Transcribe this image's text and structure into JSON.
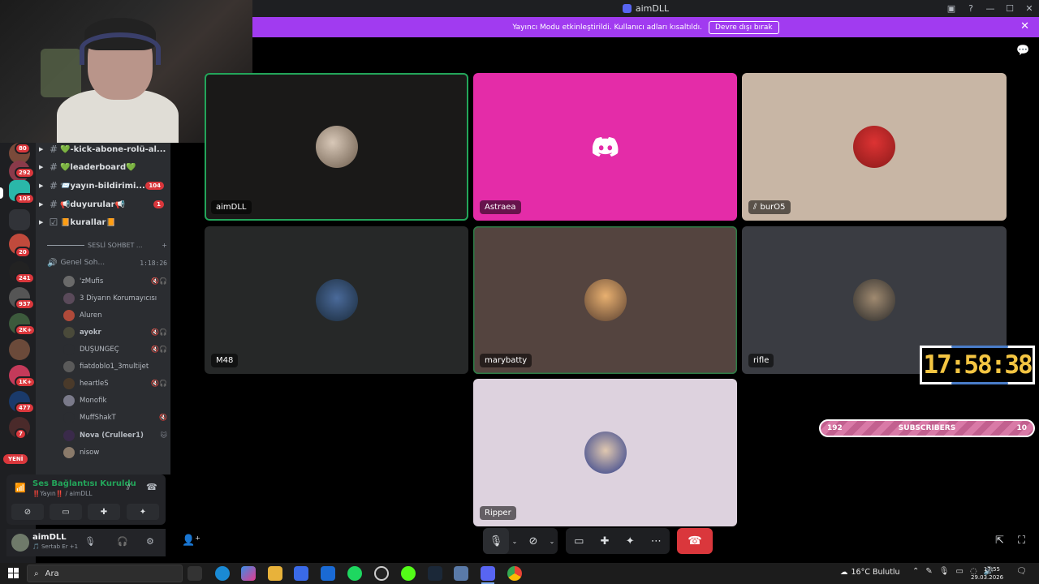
{
  "window": {
    "title": "aimDLL",
    "controls": [
      "inbox-icon",
      "help-icon",
      "minimize",
      "maximize",
      "close"
    ]
  },
  "banner": {
    "message": "Yayıncı Modu etkinleştirildi. Kullanıcı adları kısaltıldı.",
    "button_label": "Devre dışı bırak"
  },
  "server_rail": {
    "badges": [
      "80",
      "292",
      "105",
      "20",
      "241",
      "937",
      "2K+",
      "1K+",
      "477",
      "7"
    ],
    "new_label": "YENİ"
  },
  "channels": {
    "text_channels": [
      {
        "name": "💚-kick-abone-rolü-al...",
        "badge": ""
      },
      {
        "name": "💚leaderboard💚",
        "badge": ""
      },
      {
        "name": "📨yayın-bildirimi...",
        "badge": "104"
      },
      {
        "name": "📢duyurular📢",
        "badge": "1"
      },
      {
        "name": "📙kurallar📙",
        "badge": ""
      }
    ],
    "category": "SESLİ SOHBET ...",
    "voice_channel": {
      "name": "Genel Soh...",
      "timer": "1:18:26"
    },
    "voice_users": [
      {
        "name": "'zMufis",
        "icons": "🔇🎧"
      },
      {
        "name": "3 Diyarın Korumayıcısı",
        "icons": ""
      },
      {
        "name": "Aluren",
        "icons": ""
      },
      {
        "name": "ayokr",
        "icons": "🔇🎧"
      },
      {
        "name": "DÜŞÜNGEÇ",
        "icons": "🔇🎧"
      },
      {
        "name": "fiatdoblo1_3multijet",
        "icons": ""
      },
      {
        "name": "heartleS",
        "icons": "🔇🎧"
      },
      {
        "name": "Monofik",
        "icons": ""
      },
      {
        "name": "MuffShakT",
        "icons": "🔇"
      },
      {
        "name": "Nova (Crulleer1)",
        "icons": "🐱"
      },
      {
        "name": "nisow",
        "icons": ""
      }
    ]
  },
  "voice_panel": {
    "status": "Ses Bağlantısı Kuruldu",
    "sub": "‼️Yayın‼️ / aimDLL"
  },
  "user_panel": {
    "name": "aimDLL",
    "status": "🎵 Sertab Er +1"
  },
  "tiles": [
    {
      "name": "aimDLL",
      "bg": "#1a1918",
      "muted": false,
      "type": "avatar"
    },
    {
      "name": "Astraea",
      "bg": "#e42ca8",
      "muted": false,
      "type": "discord"
    },
    {
      "name": "burO5",
      "bg": "#c8b6a5",
      "muted": true,
      "type": "avatar"
    },
    {
      "name": "M48",
      "bg": "#262828",
      "muted": false,
      "type": "avatar"
    },
    {
      "name": "marybatty",
      "bg": "#54443f",
      "muted": false,
      "type": "avatar"
    },
    {
      "name": "rifle",
      "bg": "#3a3c42",
      "muted": false,
      "type": "avatar"
    },
    {
      "name": "Ripper",
      "bg": "#ddd2de",
      "muted": false,
      "type": "avatar"
    }
  ],
  "clock_overlay": {
    "time": "17:58:38"
  },
  "subscribers_bar": {
    "left": "192",
    "label": "SUBSCRIBERS",
    "right": "10"
  },
  "taskbar": {
    "search_placeholder": "Ara",
    "weather": "16°C  Bulutlu",
    "time": "17:55",
    "date": "29.03.2026"
  },
  "colors": {
    "banner": "#a13bf0",
    "hangup": "#da373c",
    "speaking": "#23a55a",
    "clock_digits": "#f4c542"
  }
}
